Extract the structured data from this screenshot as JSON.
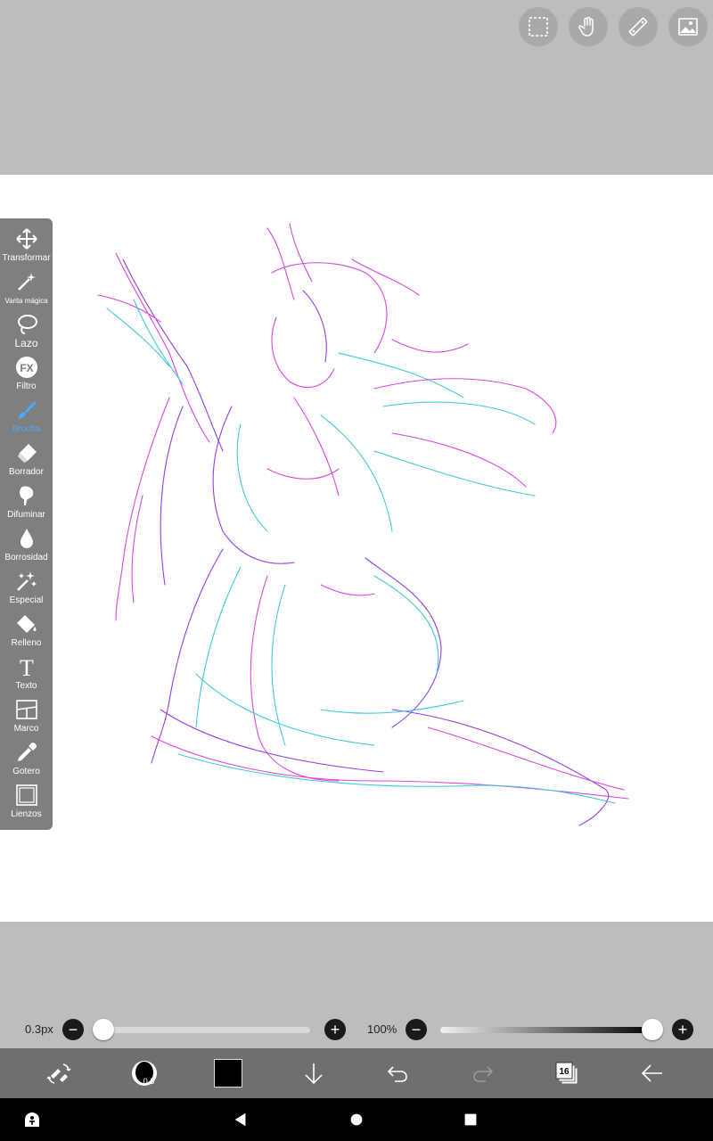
{
  "top_buttons": [
    {
      "icon": "selection-icon"
    },
    {
      "icon": "hand-icon"
    },
    {
      "icon": "ruler-icon"
    },
    {
      "icon": "image-icon"
    }
  ],
  "toolbar": {
    "items": [
      {
        "label": "Transformar",
        "icon": "move-arrows-icon"
      },
      {
        "label": "Varita mágica",
        "icon": "magic-wand-icon"
      },
      {
        "label": "Lazo",
        "icon": "lasso-icon"
      },
      {
        "label": "Filtro",
        "icon": "fx-icon",
        "icon_text": "FX"
      },
      {
        "label": "Brocha",
        "icon": "brush-icon",
        "active": true
      },
      {
        "label": "Borrador",
        "icon": "eraser-icon"
      },
      {
        "label": "Difuminar",
        "icon": "smudge-icon"
      },
      {
        "label": "Borrosidad",
        "icon": "blur-drop-icon"
      },
      {
        "label": "Especial",
        "icon": "special-sparkle-icon"
      },
      {
        "label": "Relleno",
        "icon": "fill-bucket-icon"
      },
      {
        "label": "Texto",
        "icon": "text-icon",
        "icon_text": "T"
      },
      {
        "label": "Marco",
        "icon": "frame-icon"
      },
      {
        "label": "Gotero",
        "icon": "eyedropper-icon"
      },
      {
        "label": "Lienzos",
        "icon": "canvas-icon"
      }
    ],
    "active_color": "#4aa8ff"
  },
  "brush": {
    "size_label": "0.3px",
    "size_value": 0.0,
    "opacity_label": "100%",
    "opacity_value": 1.0,
    "minus": "−",
    "plus": "+"
  },
  "action_bar": {
    "brush_preview_value": "0.3",
    "color": "#000000",
    "layers_count": "16"
  },
  "colors": {
    "sketch_magenta": "#d633e0",
    "sketch_cyan": "#2ec4d6",
    "sketch_purple": "#8a2be2",
    "toolbar_bg": "#7f7f7f",
    "workspace_bg": "#bdbdbd"
  }
}
